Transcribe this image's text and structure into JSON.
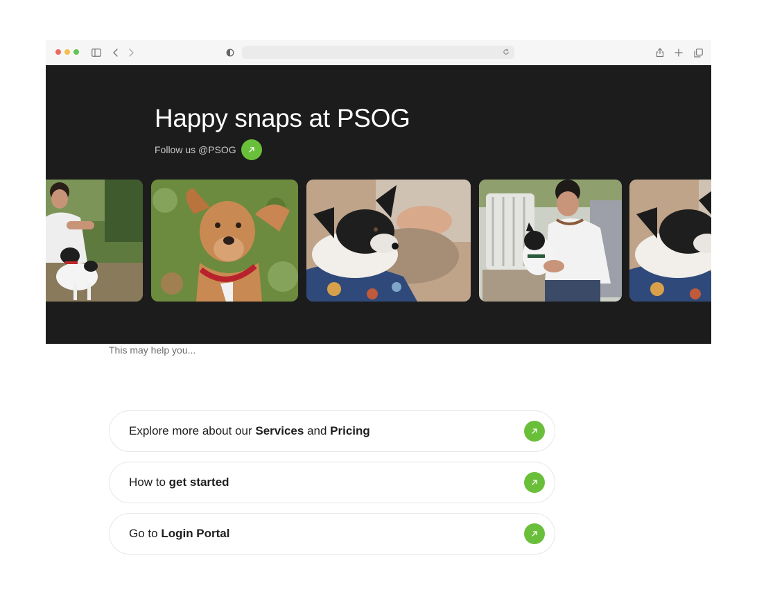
{
  "browser": {
    "icons": [
      "sidebar-icon",
      "back-icon",
      "forward-icon",
      "privacy-shield-icon",
      "reload-icon",
      "share-icon",
      "new-tab-icon",
      "tabs-overview-icon"
    ],
    "url": ""
  },
  "hero": {
    "title": "Happy snaps at PSOG",
    "follow_text": "Follow us @PSOG",
    "background": "#1c1c1c"
  },
  "gallery": {
    "photos": [
      "man-with-small-dog",
      "brown-puppy-red-collar",
      "black-dog-on-pillow",
      "man-holding-dog-on-chair",
      "black-dog-on-pillow"
    ]
  },
  "help": {
    "heading": "This may help you...",
    "links": [
      {
        "parts": [
          "Explore more about our ",
          "Services",
          " and ",
          "Pricing"
        ]
      },
      {
        "parts": [
          "How to ",
          "get started"
        ]
      },
      {
        "parts": [
          "Go to ",
          "Login Portal"
        ]
      }
    ]
  },
  "colors": {
    "accent": "#6abf3a",
    "text": "#1e1e1e",
    "muted": "#6b6b6b"
  }
}
